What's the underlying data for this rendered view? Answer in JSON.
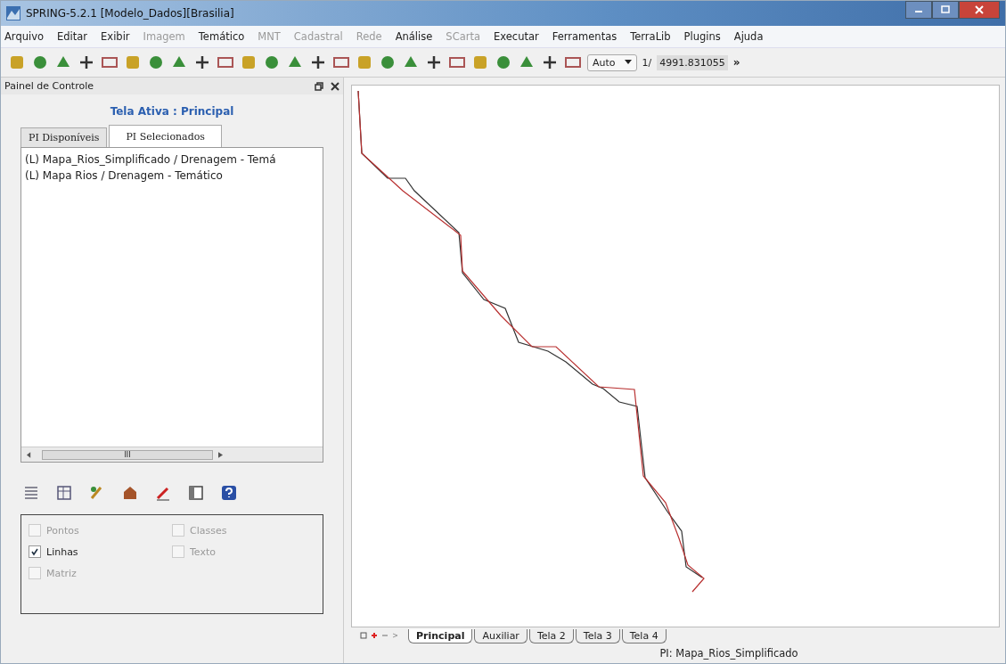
{
  "window": {
    "title": "SPRING-5.2.1 [Modelo_Dados][Brasilia]"
  },
  "menu": [
    {
      "label": "Arquivo",
      "disabled": false
    },
    {
      "label": "Editar",
      "disabled": false
    },
    {
      "label": "Exibir",
      "disabled": false
    },
    {
      "label": "Imagem",
      "disabled": true
    },
    {
      "label": "Temático",
      "disabled": false
    },
    {
      "label": "MNT",
      "disabled": true
    },
    {
      "label": "Cadastral",
      "disabled": true
    },
    {
      "label": "Rede",
      "disabled": true
    },
    {
      "label": "Análise",
      "disabled": false
    },
    {
      "label": "SCarta",
      "disabled": true
    },
    {
      "label": "Executar",
      "disabled": false
    },
    {
      "label": "Ferramentas",
      "disabled": false
    },
    {
      "label": "TerraLib",
      "disabled": false
    },
    {
      "label": "Plugins",
      "disabled": false
    },
    {
      "label": "Ajuda",
      "disabled": false
    }
  ],
  "toolbar": {
    "scale_mode": "Auto",
    "scale_prefix": "1/",
    "scale_value": "4991.831055",
    "more": "»"
  },
  "control_panel": {
    "title": "Painel de Controle",
    "active_screen": "Tela Ativa : Principal",
    "tabs": [
      {
        "label": "PI Disponíveis",
        "selected": false
      },
      {
        "label": "PI Selecionados",
        "selected": true
      }
    ],
    "layers": [
      "(L) Mapa_Rios_Simplificado / Drenagem - Temá",
      "(L) Mapa Rios / Drenagem - Temático"
    ],
    "scroll_mark": "III",
    "options": [
      {
        "label": "Pontos",
        "checked": false,
        "disabled": true
      },
      {
        "label": "Classes",
        "checked": false,
        "disabled": true
      },
      {
        "label": "Linhas",
        "checked": true,
        "disabled": false
      },
      {
        "label": "Texto",
        "checked": false,
        "disabled": true
      },
      {
        "label": "Matriz",
        "checked": false,
        "disabled": true
      }
    ]
  },
  "screen_tabs": [
    {
      "label": "Principal",
      "selected": true
    },
    {
      "label": "Auxiliar",
      "selected": false
    },
    {
      "label": "Tela 2",
      "selected": false
    },
    {
      "label": "Tela 3",
      "selected": false
    },
    {
      "label": "Tela 4",
      "selected": false
    }
  ],
  "status_bar": {
    "pi": "PI: Mapa_Rios_Simplificado"
  }
}
